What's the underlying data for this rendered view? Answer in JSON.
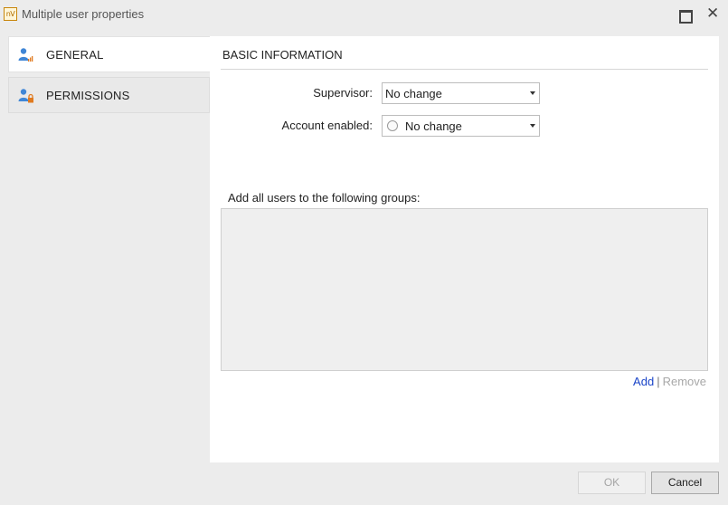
{
  "window": {
    "app_icon_text": "nV",
    "title": "Multiple user properties"
  },
  "nav": {
    "items": [
      {
        "label": "GENERAL",
        "icon": "user-signal-icon",
        "active": true
      },
      {
        "label": "PERMISSIONS",
        "icon": "user-lock-icon",
        "active": false
      }
    ]
  },
  "main": {
    "section_title": "BASIC INFORMATION",
    "supervisor": {
      "label": "Supervisor:",
      "value": "No change"
    },
    "account_enabled": {
      "label": "Account enabled:",
      "value": "No change"
    },
    "groups_label": "Add all users to the following groups:",
    "groups": [],
    "add_link": "Add",
    "link_separator": "|",
    "remove_link": "Remove"
  },
  "footer": {
    "ok_label": "OK",
    "cancel_label": "Cancel"
  },
  "colors": {
    "link_enabled": "#1a44c8",
    "link_disabled": "#a8a8a8",
    "icon_blue": "#3f86d6",
    "icon_orange": "#e07a1f"
  }
}
